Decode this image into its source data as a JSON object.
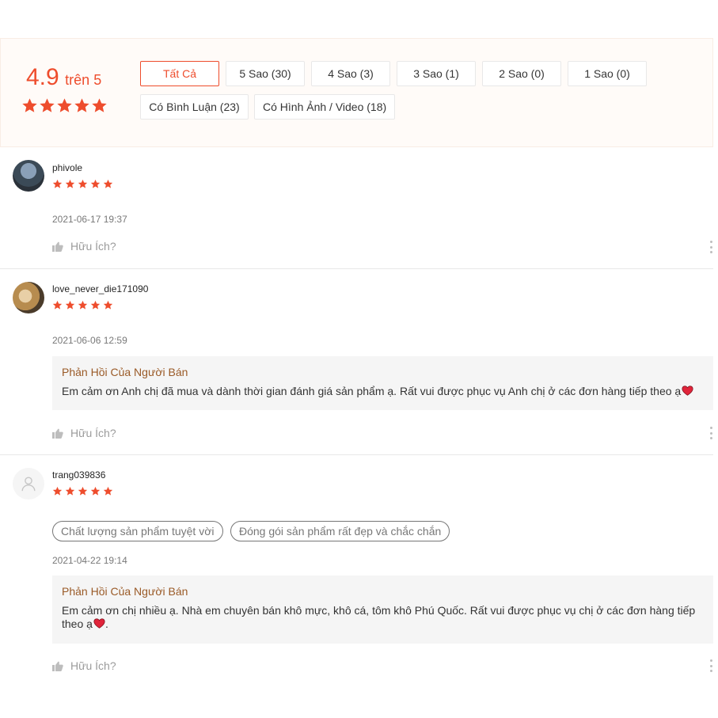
{
  "summary": {
    "score": "4.9",
    "out_of": "trên 5",
    "rating_stars": 5,
    "accent_color": "#ee4d2d"
  },
  "filters": [
    {
      "label": "Tất Cả",
      "active": true
    },
    {
      "label": "5 Sao (30)",
      "active": false
    },
    {
      "label": "4 Sao (3)",
      "active": false
    },
    {
      "label": "3 Sao (1)",
      "active": false
    },
    {
      "label": "2 Sao (0)",
      "active": false
    },
    {
      "label": "1 Sao (0)",
      "active": false
    },
    {
      "label": "Có Bình Luận (23)",
      "active": false
    },
    {
      "label": "Có Hình Ảnh / Video (18)",
      "active": false
    }
  ],
  "reviews": [
    {
      "username": "phivole",
      "stars": 5,
      "datetime": "2021-06-17 19:37",
      "helpful_label": "Hữu Ích?"
    },
    {
      "username": "love_never_die171090",
      "stars": 5,
      "datetime": "2021-06-06 12:59",
      "reply": {
        "title": "Phản Hồi Của Người Bán",
        "body": "Em cảm ơn Anh chị đã mua và dành thời gian đánh giá sản phẩm ạ. Rất vui được phục vụ Anh chị ở các đơn hàng tiếp theo ạ"
      },
      "helpful_label": "Hữu Ích?"
    },
    {
      "username": "trang039836",
      "stars": 5,
      "tags": [
        "Chất lượng sản phẩm tuyệt vời",
        "Đóng gói sản phẩm rất đẹp và chắc chắn"
      ],
      "datetime": "2021-04-22 19:14",
      "reply": {
        "title": "Phản Hồi Của Người Bán",
        "body_line1": "Em cảm ơn chị nhiều ạ. Nhà em chuyên bán khô mực, khô cá, tôm khô Phú Quốc. Rất vui được phục vụ chị ở các đơn hàng tiếp",
        "body_line2": "theo ạ",
        "body_end": "."
      },
      "helpful_label": "Hữu Ích?"
    }
  ],
  "icons": {
    "star": "star-icon",
    "heart": "heart-emoji-icon",
    "thumb": "thumbs-up-icon",
    "more": "more-vertical-icon",
    "default_avatar": "user-icon"
  }
}
